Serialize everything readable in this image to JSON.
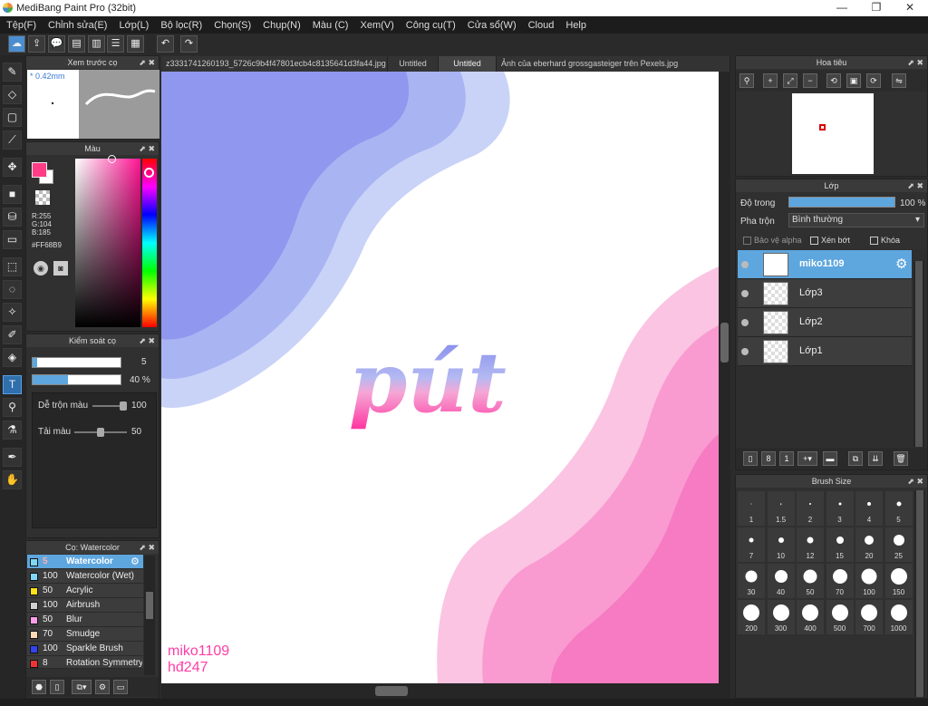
{
  "window": {
    "title": "MediBang Paint Pro (32bit)",
    "min": "—",
    "max": "❐",
    "close": "✕"
  },
  "menu": [
    "Tệp(F)",
    "Chỉnh sửa(E)",
    "Lớp(L)",
    "Bộ lọc(R)",
    "Chọn(S)",
    "Chụp(N)",
    "Màu (C)",
    "Xem(V)",
    "Công cụ(T)",
    "Cửa sổ(W)",
    "Cloud",
    "Help"
  ],
  "tabs": [
    "z3331741260193_5726c9b4f47801ecb4c8135641d3fa44.jpg",
    "Untitled",
    "Untitled",
    "Ảnh của eberhard grossgasteiger trên Pexels.jpg"
  ],
  "preview": {
    "title": "Xem trước cọ",
    "size": "* 0.42mm"
  },
  "color": {
    "title": "Màu",
    "r": "R:255",
    "g": "G:104",
    "b": "B:185",
    "hex": "#FF68B9",
    "fg": "#ff3d86"
  },
  "brushctl": {
    "title": "Kiểm soát cọ",
    "size_val": "5",
    "opacity_val": "40 %",
    "blend_label": "Dễ trộn màu",
    "blend_val": "100",
    "reload_label": "Tải màu",
    "reload_val": "50",
    "size_fill": 0.05,
    "opacity_fill": 0.4,
    "blend_fill": 1.0,
    "reload_fill": 0.5
  },
  "brushes": {
    "title": "Cọ: Watercolor",
    "items": [
      {
        "n": "5",
        "l": "Watercolor",
        "c": "#7fd7f7"
      },
      {
        "n": "100",
        "l": "Watercolor (Wet)",
        "c": "#7fd7f7"
      },
      {
        "n": "50",
        "l": "Acrylic",
        "c": "#ffe11a"
      },
      {
        "n": "100",
        "l": "Airbrush",
        "c": "#cfcfcf"
      },
      {
        "n": "50",
        "l": "Blur",
        "c": "#ff9ee8"
      },
      {
        "n": "70",
        "l": "Smudge",
        "c": "#ffd8b8"
      },
      {
        "n": "100",
        "l": "Sparkle Brush",
        "c": "#3344ee"
      },
      {
        "n": "8",
        "l": "Rotation Symmetry",
        "c": "#ee3333"
      }
    ]
  },
  "navigator": {
    "title": "Hoa tiêu"
  },
  "layers": {
    "title": "Lớp",
    "opacity_label": "Độ trong",
    "opacity_val": "100 %",
    "opacity_fill": 1.0,
    "blend_label": "Pha trộn",
    "blend_val": "Bình thường",
    "protect_alpha": "Bảo vệ alpha",
    "clip": "Xén bớt",
    "lock": "Khóa",
    "items": [
      "miko1109",
      "Lớp3",
      "Lớp2",
      "Lớp1"
    ]
  },
  "brushsize": {
    "title": "Brush Size",
    "sizes": [
      "1",
      "1.5",
      "2",
      "3",
      "4",
      "5",
      "7",
      "10",
      "12",
      "15",
      "20",
      "25",
      "30",
      "40",
      "50",
      "70",
      "100",
      "150",
      "200",
      "300",
      "400",
      "500",
      "700",
      "1000"
    ]
  },
  "canvas": {
    "word": "pút",
    "sig1": "miko1109",
    "sig2": "hđ247"
  }
}
